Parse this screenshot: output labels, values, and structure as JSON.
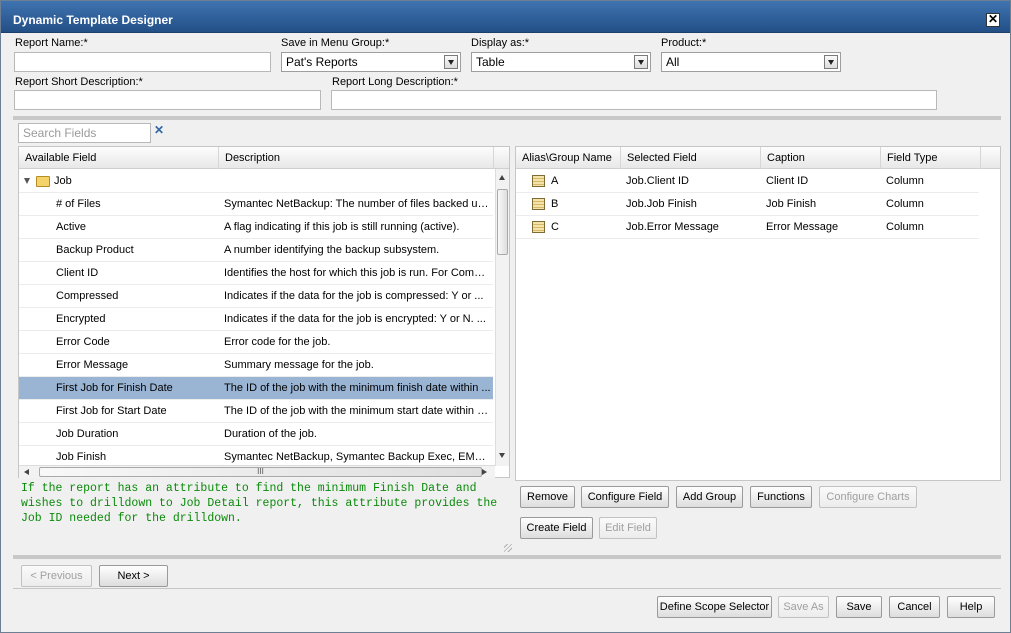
{
  "window": {
    "title": "Dynamic Template Designer",
    "close": "✕"
  },
  "form": {
    "report_name_label": "Report Name:*",
    "report_name_value": "",
    "menu_group_label": "Save in Menu Group:*",
    "menu_group_value": "Pat's Reports",
    "display_as_label": "Display as:*",
    "display_as_value": "Table",
    "product_label": "Product:*",
    "product_value": "All",
    "short_desc_label": "Report Short Description:*",
    "long_desc_label": "Report Long Description:*"
  },
  "search": {
    "placeholder": "Search Fields",
    "clear": "✕"
  },
  "available": {
    "headers": {
      "field": "Available Field",
      "description": "Description"
    },
    "group": "Job",
    "rows": [
      {
        "field": "# of Files",
        "description": "Symantec NetBackup: The number of files backed up..."
      },
      {
        "field": "Active",
        "description": "A flag indicating if this job is still running (active)."
      },
      {
        "field": "Backup Product",
        "description": "A number identifying the backup subsystem."
      },
      {
        "field": "Client ID",
        "description": "Identifies the host for which this job is run. For Comm..."
      },
      {
        "field": "Compressed",
        "description": "Indicates if the data for the job is compressed: Y or ..."
      },
      {
        "field": "Encrypted",
        "description": "Indicates if the data for the job is encrypted: Y or N. ..."
      },
      {
        "field": "Error Code",
        "description": "Error code for the job."
      },
      {
        "field": "Error Message",
        "description": "Summary message for the job."
      },
      {
        "field": "First Job for Finish Date",
        "description": "The ID of the job with the minimum finish date within ..."
      },
      {
        "field": "First Job for Start Date",
        "description": "The ID of the job with the minimum start date within a..."
      },
      {
        "field": "Job Duration",
        "description": "Duration of the job."
      },
      {
        "field": "Job Finish",
        "description": "Symantec NetBackup, Symantec Backup Exec, EMC ..."
      }
    ],
    "selected_index": 8,
    "hscroll_grip": "III"
  },
  "info_text": "If the report has an attribute to find the minimum Finish Date and\nwishes to drilldown to Job Detail report, this attribute provides the\nJob ID needed for the drilldown.",
  "selected": {
    "headers": {
      "alias": "Alias\\Group Name",
      "field": "Selected Field",
      "caption": "Caption",
      "type": "Field Type"
    },
    "rows": [
      {
        "alias": "A",
        "field": "Job.Client ID",
        "caption": "Client ID",
        "type": "Column"
      },
      {
        "alias": "B",
        "field": "Job.Job Finish",
        "caption": "Job Finish",
        "type": "Column"
      },
      {
        "alias": "C",
        "field": "Job.Error Message",
        "caption": "Error Message",
        "type": "Column"
      }
    ]
  },
  "actions": {
    "remove": "Remove",
    "configure_field": "Configure Field",
    "add_group": "Add Group",
    "functions": "Functions",
    "configure_charts": "Configure Charts",
    "create_field": "Create Field",
    "edit_field": "Edit Field"
  },
  "nav": {
    "previous": "< Previous",
    "next": "Next >"
  },
  "footer": {
    "define_scope": "Define Scope Selector",
    "save_as": "Save As",
    "save": "Save",
    "cancel": "Cancel",
    "help": "Help"
  },
  "colors": {
    "titlebar": "#2b5a93",
    "selected_row": "#9ab5d4",
    "info_text": "#0a8a0a"
  }
}
